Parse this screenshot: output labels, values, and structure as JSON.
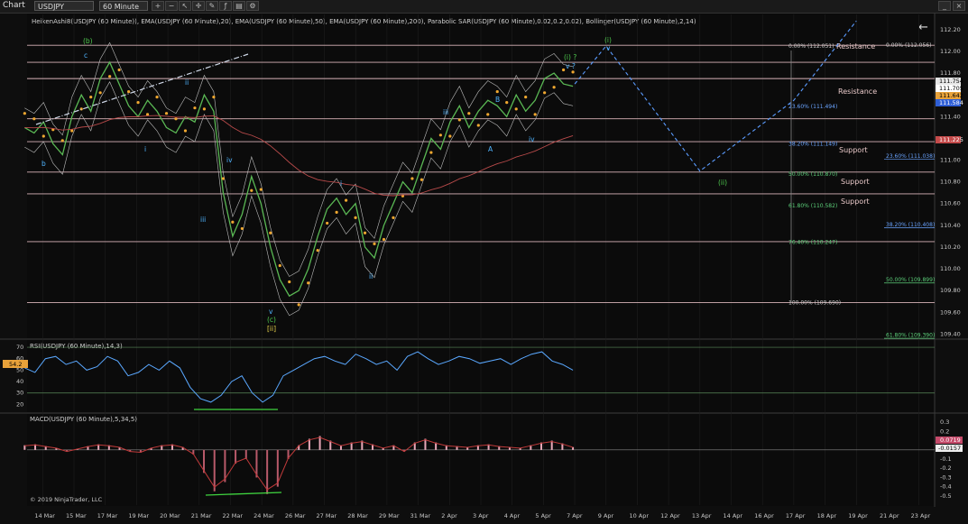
{
  "toolbar": {
    "title": "Chart",
    "instrument": "USDJPY",
    "timeframe": "60 Minute"
  },
  "indicators_line": "HeikenAshi8(USDJPY (60 Minute)), EMA(USDJPY (60 Minute),20), EMA(USDJPY (60 Minute),50), EMA(USDJPY (60 Minute),200), Parabolic SAR(USDJPY (60 Minute),0.02,0.2,0.02), Bollinger(USDJPY (60 Minute),2,14)",
  "rsi_label": "RSI(USDJPY (60 Minute),14,3)",
  "macd_label": "MACD(USDJPY (60 Minute),5,34,5)",
  "copyright": "© 2019 NinjaTrader, LLC",
  "sr_labels": {
    "resistance1": "Resistance",
    "resistance2": "Resistance",
    "support1": "Support",
    "support2": "Support",
    "support3": "Support"
  },
  "fib_left": [
    "0.00% (112.051)",
    "23.60% (111.494)",
    "38.20% (111.149)",
    "50.00% (110.870)",
    "61.80% (110.582)",
    "76.40% (110.247)",
    "100.00% (109.690)"
  ],
  "fib_right": [
    "0.00% (112.056)",
    "23.60% (111.038)",
    "38.20% (110.408)",
    "50.00% (109.899)",
    "61.80% (109.390)"
  ],
  "price_tags": {
    "p1": "111.754",
    "p2": "111.705",
    "p3": "111.642",
    "p4": "111.584",
    "p5": "111.225",
    "rsi": "54.2",
    "macd1": "0.0719",
    "macd2": "-0.0157"
  },
  "wave_labels": {
    "b_top": "(b)",
    "c": "c",
    "b": "b",
    "i1": "i",
    "ii": "ii",
    "iii": "iii",
    "iv": "iv",
    "v": "v",
    "c_paren": "(c)",
    "ii_bracket": "[ii]",
    "i2": "i",
    "ii2": "ii",
    "iii2": "iii",
    "iv2": "iv",
    "b2": "B",
    "a2": "A",
    "i_q": "(i) ?",
    "v_q": "v ?",
    "i_proj": "(i)",
    "v_proj": "v",
    "ii_proj": "(ii)"
  },
  "chart_data": [
    {
      "type": "line",
      "title": "USDJPY 60 Minute",
      "x": [
        "14 Mar",
        "15 Mar",
        "17 Mar",
        "19 Mar",
        "20 Mar",
        "21 Mar",
        "22 Mar",
        "24 Mar",
        "26 Mar",
        "27 Mar",
        "28 Mar",
        "29 Mar",
        "31 Mar",
        "2 Apr",
        "3 Apr",
        "4 Apr",
        "5 Apr",
        "7 Apr",
        "9 Apr",
        "10 Apr",
        "12 Apr",
        "13 Apr",
        "14 Apr",
        "16 Apr",
        "17 Apr",
        "18 Apr",
        "19 Apr",
        "21 Apr",
        "23 Apr"
      ],
      "yticks": [
        112.2,
        112.0,
        111.8,
        111.6,
        111.4,
        111.2,
        111.0,
        110.8,
        110.6,
        110.4,
        110.2,
        110.0,
        109.8,
        109.6,
        109.4
      ],
      "ytick_labels": [
        "112.20",
        "112.00",
        "111.80",
        "111.60",
        "111.40",
        "111.20",
        "111.00",
        "110.80",
        "110.60",
        "110.40",
        "110.20",
        "110.00",
        "109.80",
        "109.60",
        "109.40"
      ],
      "ylim": [
        109.37,
        112.34
      ],
      "series": [
        {
          "values": [
            111.3,
            111.25,
            111.35,
            111.15,
            111.05,
            111.4,
            111.6,
            111.45,
            111.75,
            111.9,
            111.7,
            111.5,
            111.4,
            111.55,
            111.45,
            111.3,
            111.25,
            111.4,
            111.35,
            111.6,
            111.45,
            110.7,
            110.3,
            110.5,
            110.85,
            110.6,
            110.2,
            109.9,
            109.75,
            109.8,
            110.0,
            110.3,
            110.55,
            110.65,
            110.5,
            110.6,
            110.2,
            110.1,
            110.4,
            110.6,
            110.8,
            110.7,
            110.95,
            111.2,
            111.1,
            111.35,
            111.5,
            111.3,
            111.45,
            111.55,
            111.5,
            111.4,
            111.6,
            111.45,
            111.55,
            111.75,
            111.8,
            111.7,
            111.68
          ]
        }
      ],
      "projection": [
        {
          "x": "7 Apr",
          "y": 111.7
        },
        {
          "x": "9 Apr",
          "y": 112.05
        },
        {
          "x": "13 Apr",
          "y": 110.9
        },
        {
          "x": "17 Apr",
          "y": 111.55
        },
        {
          "x": "19 Apr",
          "y": 112.28
        }
      ],
      "horizontal_levels": [
        112.056,
        111.9,
        111.75,
        111.38,
        111.17,
        110.89,
        110.69,
        110.25,
        109.69
      ]
    },
    {
      "type": "line",
      "title": "",
      "yticks": [
        70,
        60,
        50,
        40,
        30,
        20
      ],
      "ylim": [
        14,
        74
      ],
      "levels": [
        70,
        30
      ],
      "series": [
        {
          "values": [
            52,
            48,
            60,
            62,
            55,
            58,
            50,
            53,
            62,
            58,
            45,
            48,
            55,
            50,
            58,
            52,
            35,
            25,
            22,
            28,
            40,
            45,
            30,
            22,
            28,
            45,
            50,
            55,
            60,
            62,
            58,
            55,
            64,
            60,
            55,
            58,
            50,
            62,
            66,
            60,
            55,
            58,
            62,
            60,
            56,
            58,
            60,
            55,
            60,
            64,
            66,
            58,
            55,
            50
          ]
        }
      ]
    },
    {
      "type": "bar",
      "title": "",
      "yticks": [
        0.3,
        0.2,
        0.1,
        0,
        -0.1,
        -0.2,
        -0.3,
        -0.4,
        -0.5
      ],
      "ylim": [
        -0.56,
        0.36
      ],
      "values": [
        0.05,
        0.06,
        0.04,
        0.02,
        -0.02,
        0.01,
        0.04,
        0.06,
        0.05,
        0.03,
        -0.02,
        -0.03,
        0.02,
        0.05,
        0.06,
        0.03,
        -0.05,
        -0.25,
        -0.45,
        -0.35,
        -0.15,
        -0.1,
        -0.3,
        -0.48,
        -0.4,
        -0.1,
        0.05,
        0.12,
        0.15,
        0.1,
        0.05,
        0.08,
        0.1,
        0.06,
        0.02,
        0.05,
        -0.02,
        0.08,
        0.12,
        0.08,
        0.05,
        0.04,
        0.03,
        0.05,
        0.06,
        0.04,
        0.03,
        0.02,
        0.05,
        0.08,
        0.1,
        0.07,
        0.03
      ]
    }
  ]
}
